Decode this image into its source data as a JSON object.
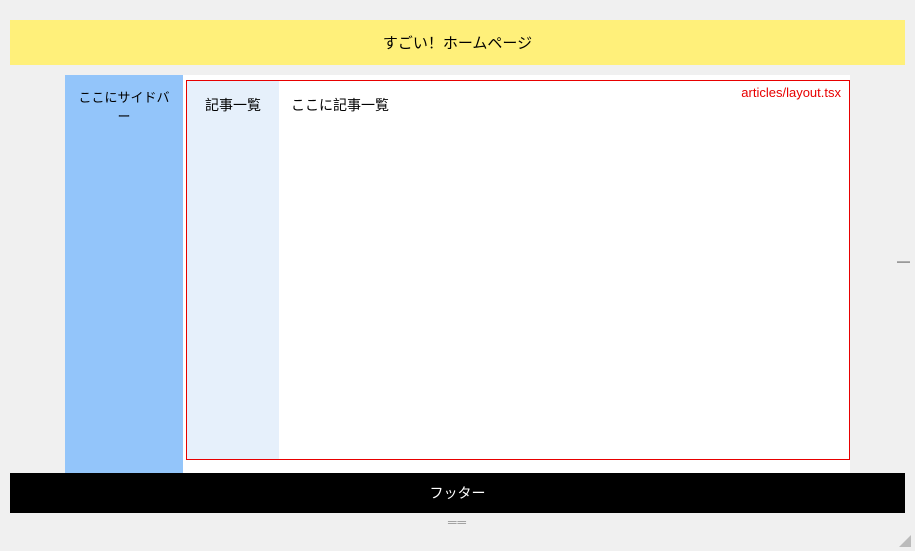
{
  "header": {
    "title": "すごい！ホームページ"
  },
  "sidebar": {
    "text": "ここにサイドバー"
  },
  "layout": {
    "label": "articles/layout.tsx",
    "articles_sidebar": "記事一覧",
    "articles_content": "ここに記事一覧"
  },
  "footer": {
    "text": "フッター"
  }
}
